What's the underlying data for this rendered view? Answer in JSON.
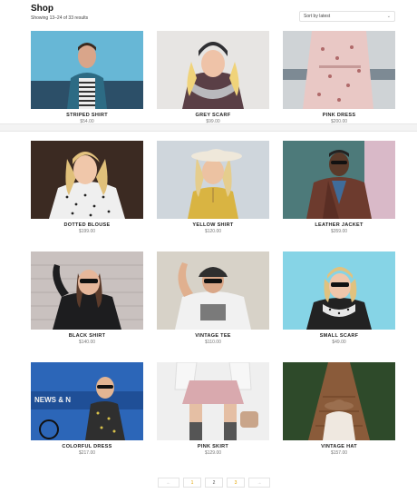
{
  "page": {
    "title": "Shop",
    "result_count": "Showing 13–24 of 33 results",
    "sort_label": "Sort by latest"
  },
  "products": [
    {
      "name": "STRIPED SHIRT",
      "price": "$54.00",
      "image": "man-in-denim-jacket"
    },
    {
      "name": "GREY SCARF",
      "price": "$99.00",
      "image": "woman-with-beanie-and-scarf"
    },
    {
      "name": "PINK DRESS",
      "price": "$200.00",
      "image": "woman-in-pink-floral-dress"
    },
    {
      "name": "DOTTED BLOUSE",
      "price": "$199.00",
      "image": "woman-in-dotted-blouse"
    },
    {
      "name": "YELLOW SHIRT",
      "price": "$120.00",
      "image": "woman-in-yellow-top-with-hat"
    },
    {
      "name": "LEATHER JACKET",
      "price": "$359.00",
      "image": "man-in-leather-jacket"
    },
    {
      "name": "BLACK SHIRT",
      "price": "$140.00",
      "image": "woman-in-black-top"
    },
    {
      "name": "VINTAGE TEE",
      "price": "$110.00",
      "image": "man-in-white-tee-with-cap"
    },
    {
      "name": "SMALL SCARF",
      "price": "$49.00",
      "image": "woman-with-scarf-on-blue"
    },
    {
      "name": "COLORFUL DRESS",
      "price": "$217.00",
      "image": "woman-in-colorful-dress-with-bike"
    },
    {
      "name": "PINK SKIRT",
      "price": "$129.00",
      "image": "woman-in-pink-skirt-with-bag"
    },
    {
      "name": "VINTAGE HAT",
      "price": "$157.00",
      "image": "woman-with-hat-on-bridge"
    }
  ],
  "pagination": {
    "prev": "←",
    "pages": [
      "1",
      "2",
      "3"
    ],
    "current": "1",
    "next": "→"
  },
  "colors": {
    "accent": "#e2a400",
    "price_text": "#777777",
    "title_text": "#111111"
  }
}
